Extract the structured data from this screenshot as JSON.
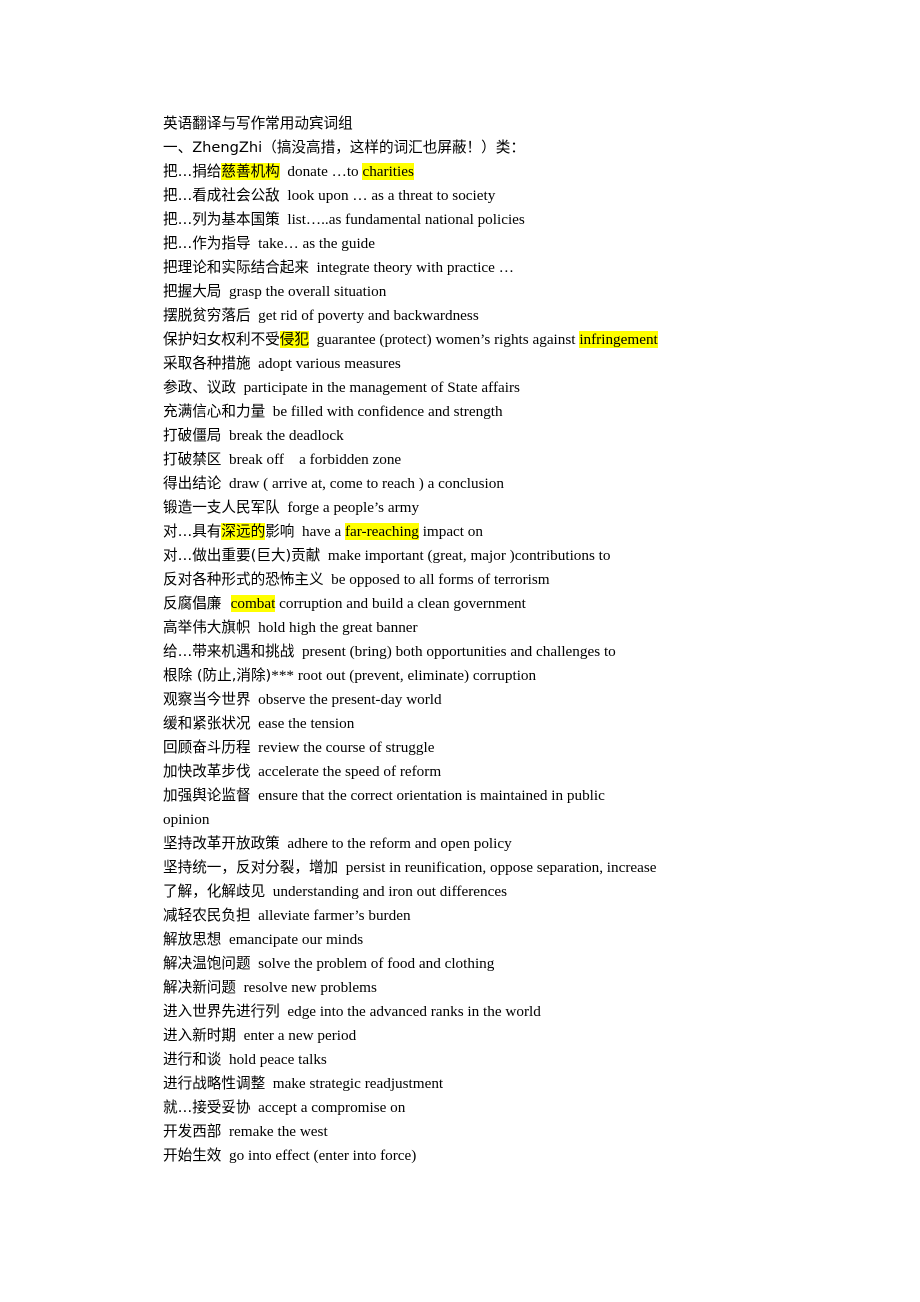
{
  "document": {
    "title": "英语翻译与写作常用动宾词组",
    "highlight_color": "#ffff00",
    "text_color": "#000000",
    "background_color": "#ffffff",
    "lines": [
      {
        "id": "title",
        "segments": [
          {
            "text": "英语翻译与写作常用动宾词组",
            "highlight": false,
            "cjk": true
          }
        ]
      },
      {
        "id": "section-heading",
        "segments": [
          {
            "text": "一、ZhengZhi（搞没高措，这样的词汇也屏蔽！）类：",
            "highlight": false,
            "cjk": true
          }
        ]
      },
      {
        "id": "entry-1",
        "segments": [
          {
            "text": "把…捐给",
            "highlight": false,
            "cjk": true
          },
          {
            "text": "慈善机构",
            "highlight": true,
            "cjk": true
          },
          {
            "text": "  donate …to ",
            "highlight": false,
            "cjk": false
          },
          {
            "text": "charities",
            "highlight": true,
            "cjk": false
          }
        ]
      },
      {
        "id": "entry-2",
        "segments": [
          {
            "text": "把…看成社会公敌",
            "highlight": false,
            "cjk": true
          },
          {
            "text": "  look upon … as a threat to society",
            "highlight": false,
            "cjk": false
          }
        ]
      },
      {
        "id": "entry-3",
        "segments": [
          {
            "text": "把…列为基本国策",
            "highlight": false,
            "cjk": true
          },
          {
            "text": "  list…..as fundamental national policies",
            "highlight": false,
            "cjk": false
          }
        ]
      },
      {
        "id": "entry-4",
        "segments": [
          {
            "text": "把…作为指导",
            "highlight": false,
            "cjk": true
          },
          {
            "text": "  take… as the guide",
            "highlight": false,
            "cjk": false
          }
        ]
      },
      {
        "id": "entry-5",
        "segments": [
          {
            "text": "把理论和实际结合起来",
            "highlight": false,
            "cjk": true
          },
          {
            "text": "  integrate theory with practice …",
            "highlight": false,
            "cjk": false
          }
        ]
      },
      {
        "id": "entry-6",
        "segments": [
          {
            "text": "把握大局",
            "highlight": false,
            "cjk": true
          },
          {
            "text": "  grasp the overall situation",
            "highlight": false,
            "cjk": false
          }
        ]
      },
      {
        "id": "entry-7",
        "segments": [
          {
            "text": "摆脱贫穷落后",
            "highlight": false,
            "cjk": true
          },
          {
            "text": "  get rid of poverty and backwardness",
            "highlight": false,
            "cjk": false
          }
        ]
      },
      {
        "id": "entry-8",
        "segments": [
          {
            "text": "保护妇女权利不受",
            "highlight": false,
            "cjk": true
          },
          {
            "text": "侵犯",
            "highlight": true,
            "cjk": true
          },
          {
            "text": "  guarantee (protect) women’s rights against ",
            "highlight": false,
            "cjk": false
          },
          {
            "text": "infringement",
            "highlight": true,
            "cjk": false
          }
        ]
      },
      {
        "id": "entry-9",
        "segments": [
          {
            "text": "采取各种措施",
            "highlight": false,
            "cjk": true
          },
          {
            "text": "  adopt various measures",
            "highlight": false,
            "cjk": false
          }
        ]
      },
      {
        "id": "entry-10",
        "segments": [
          {
            "text": "参政、议政",
            "highlight": false,
            "cjk": true
          },
          {
            "text": "  participate in the management of State affairs",
            "highlight": false,
            "cjk": false
          }
        ]
      },
      {
        "id": "entry-11",
        "segments": [
          {
            "text": "充满信心和力量",
            "highlight": false,
            "cjk": true
          },
          {
            "text": "  be filled with confidence and strength",
            "highlight": false,
            "cjk": false
          }
        ]
      },
      {
        "id": "entry-12",
        "segments": [
          {
            "text": "打破僵局",
            "highlight": false,
            "cjk": true
          },
          {
            "text": "  break the deadlock",
            "highlight": false,
            "cjk": false
          }
        ]
      },
      {
        "id": "entry-13",
        "segments": [
          {
            "text": "打破禁区",
            "highlight": false,
            "cjk": true
          },
          {
            "text": "  break off    a forbidden zone",
            "highlight": false,
            "cjk": false
          }
        ]
      },
      {
        "id": "entry-14",
        "segments": [
          {
            "text": "得出结论",
            "highlight": false,
            "cjk": true
          },
          {
            "text": "  draw ( arrive at, come to reach ) a conclusion",
            "highlight": false,
            "cjk": false
          }
        ]
      },
      {
        "id": "entry-15",
        "segments": [
          {
            "text": "锻造一支人民军队",
            "highlight": false,
            "cjk": true
          },
          {
            "text": "  forge a people’s army",
            "highlight": false,
            "cjk": false
          }
        ]
      },
      {
        "id": "entry-16",
        "segments": [
          {
            "text": "对…具有",
            "highlight": false,
            "cjk": true
          },
          {
            "text": "深远的",
            "highlight": true,
            "cjk": true
          },
          {
            "text": "影响",
            "highlight": false,
            "cjk": true
          },
          {
            "text": "  have a ",
            "highlight": false,
            "cjk": false
          },
          {
            "text": "far-reaching",
            "highlight": true,
            "cjk": false
          },
          {
            "text": " impact on",
            "highlight": false,
            "cjk": false
          }
        ]
      },
      {
        "id": "entry-17",
        "segments": [
          {
            "text": "对…做出重要(巨大)贡献",
            "highlight": false,
            "cjk": true
          },
          {
            "text": "  make important (great, major )contributions to",
            "highlight": false,
            "cjk": false
          }
        ]
      },
      {
        "id": "entry-18",
        "segments": [
          {
            "text": "反对各种形式的恐怖主义",
            "highlight": false,
            "cjk": true
          },
          {
            "text": "  be opposed to all forms of terrorism",
            "highlight": false,
            "cjk": false
          }
        ]
      },
      {
        "id": "entry-19",
        "segments": [
          {
            "text": "反腐倡廉  ",
            "highlight": false,
            "cjk": true
          },
          {
            "text": "combat",
            "highlight": true,
            "cjk": false
          },
          {
            "text": " corruption and build a clean government",
            "highlight": false,
            "cjk": false
          }
        ]
      },
      {
        "id": "entry-20",
        "segments": [
          {
            "text": "高举伟大旗帜",
            "highlight": false,
            "cjk": true
          },
          {
            "text": "  hold high the great banner",
            "highlight": false,
            "cjk": false
          }
        ]
      },
      {
        "id": "entry-21",
        "segments": [
          {
            "text": "给…带来机遇和挑战",
            "highlight": false,
            "cjk": true
          },
          {
            "text": "  present (bring) both opportunities and challenges to",
            "highlight": false,
            "cjk": false
          }
        ]
      },
      {
        "id": "entry-22",
        "segments": [
          {
            "text": "根除 (防止,消除)",
            "highlight": false,
            "cjk": true
          },
          {
            "text": "*** root out (prevent, eliminate) corruption",
            "highlight": false,
            "cjk": false
          }
        ]
      },
      {
        "id": "entry-23",
        "segments": [
          {
            "text": "观察当今世界",
            "highlight": false,
            "cjk": true
          },
          {
            "text": "  observe the present-day world",
            "highlight": false,
            "cjk": false
          }
        ]
      },
      {
        "id": "entry-24",
        "segments": [
          {
            "text": "缓和紧张状况",
            "highlight": false,
            "cjk": true
          },
          {
            "text": "  ease the tension",
            "highlight": false,
            "cjk": false
          }
        ]
      },
      {
        "id": "entry-25",
        "segments": [
          {
            "text": "回顾奋斗历程",
            "highlight": false,
            "cjk": true
          },
          {
            "text": "  review the course of struggle",
            "highlight": false,
            "cjk": false
          }
        ]
      },
      {
        "id": "entry-26",
        "segments": [
          {
            "text": "加快改革步伐",
            "highlight": false,
            "cjk": true
          },
          {
            "text": "  accelerate the speed of reform",
            "highlight": false,
            "cjk": false
          }
        ]
      },
      {
        "id": "entry-27",
        "segments": [
          {
            "text": "加强舆论监督",
            "highlight": false,
            "cjk": true
          },
          {
            "text": "  ensure that the correct orientation is maintained in public",
            "highlight": false,
            "cjk": false
          }
        ]
      },
      {
        "id": "entry-27-wrap",
        "segments": [
          {
            "text": "opinion",
            "highlight": false,
            "cjk": false
          }
        ]
      },
      {
        "id": "entry-28",
        "segments": [
          {
            "text": "坚持改革开放政策",
            "highlight": false,
            "cjk": true
          },
          {
            "text": "  adhere to the reform and open policy",
            "highlight": false,
            "cjk": false
          }
        ]
      },
      {
        "id": "entry-29",
        "segments": [
          {
            "text": "坚持统一，反对分裂，增加",
            "highlight": false,
            "cjk": true
          },
          {
            "text": "  persist in reunification, oppose separation, increase",
            "highlight": false,
            "cjk": false
          }
        ]
      },
      {
        "id": "entry-29-wrap",
        "segments": [
          {
            "text": "了解，化解歧见",
            "highlight": false,
            "cjk": true
          },
          {
            "text": "  understanding and iron out differences",
            "highlight": false,
            "cjk": false
          }
        ]
      },
      {
        "id": "entry-30",
        "segments": [
          {
            "text": "减轻农民负担",
            "highlight": false,
            "cjk": true
          },
          {
            "text": "  alleviate farmer’s burden",
            "highlight": false,
            "cjk": false
          }
        ]
      },
      {
        "id": "entry-31",
        "segments": [
          {
            "text": "解放思想",
            "highlight": false,
            "cjk": true
          },
          {
            "text": "  emancipate our minds",
            "highlight": false,
            "cjk": false
          }
        ]
      },
      {
        "id": "entry-32",
        "segments": [
          {
            "text": "解决温饱问题",
            "highlight": false,
            "cjk": true
          },
          {
            "text": "  solve the problem of food and clothing",
            "highlight": false,
            "cjk": false
          }
        ]
      },
      {
        "id": "entry-33",
        "segments": [
          {
            "text": "解决新问题",
            "highlight": false,
            "cjk": true
          },
          {
            "text": "  resolve new problems",
            "highlight": false,
            "cjk": false
          }
        ]
      },
      {
        "id": "entry-34",
        "segments": [
          {
            "text": "进入世界先进行列",
            "highlight": false,
            "cjk": true
          },
          {
            "text": "  edge into the advanced ranks in the world",
            "highlight": false,
            "cjk": false
          }
        ]
      },
      {
        "id": "entry-35",
        "segments": [
          {
            "text": "进入新时期",
            "highlight": false,
            "cjk": true
          },
          {
            "text": "  enter a new period",
            "highlight": false,
            "cjk": false
          }
        ]
      },
      {
        "id": "entry-36",
        "segments": [
          {
            "text": "进行和谈",
            "highlight": false,
            "cjk": true
          },
          {
            "text": "  hold peace talks",
            "highlight": false,
            "cjk": false
          }
        ]
      },
      {
        "id": "entry-37",
        "segments": [
          {
            "text": "进行战略性调整",
            "highlight": false,
            "cjk": true
          },
          {
            "text": "  make strategic readjustment",
            "highlight": false,
            "cjk": false
          }
        ]
      },
      {
        "id": "entry-38",
        "segments": [
          {
            "text": "就…接受妥协",
            "highlight": false,
            "cjk": true
          },
          {
            "text": "  accept a compromise on",
            "highlight": false,
            "cjk": false
          }
        ]
      },
      {
        "id": "entry-39",
        "segments": [
          {
            "text": "开发西部",
            "highlight": false,
            "cjk": true
          },
          {
            "text": "  remake the west",
            "highlight": false,
            "cjk": false
          }
        ]
      },
      {
        "id": "entry-40",
        "segments": [
          {
            "text": "开始生效",
            "highlight": false,
            "cjk": true
          },
          {
            "text": "  go into effect (enter into force)",
            "highlight": false,
            "cjk": false
          }
        ]
      }
    ]
  }
}
